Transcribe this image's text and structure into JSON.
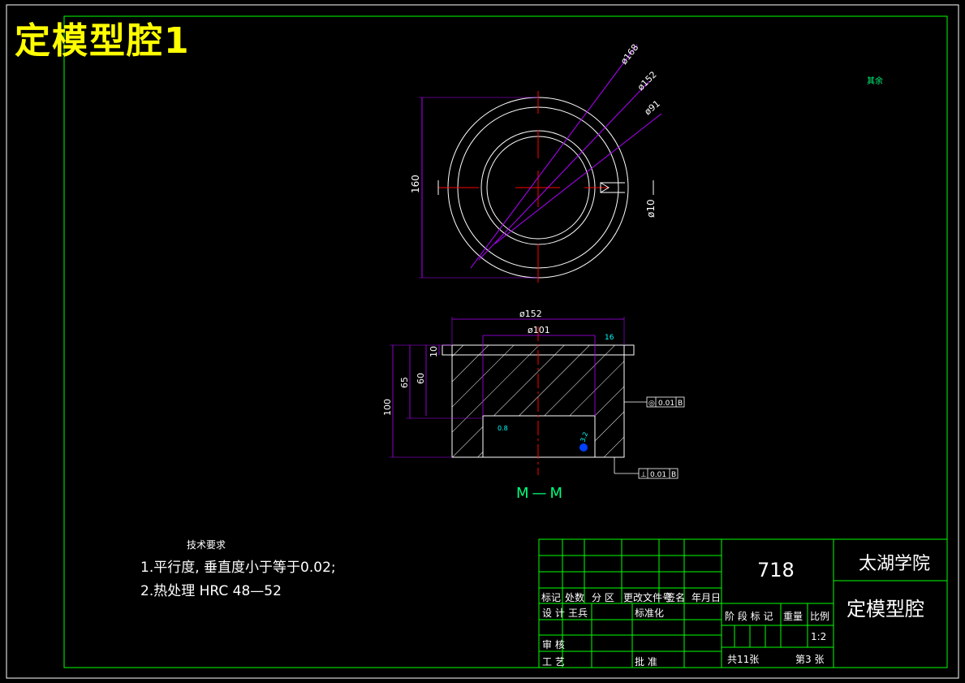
{
  "header": {
    "title": "定模型腔1"
  },
  "top_view": {
    "dims": {
      "d168": "ø168",
      "d152": "ø152",
      "d91": "ø91",
      "h160": "160",
      "d10": "ø10",
      "roughness_rest": "其余"
    }
  },
  "section_view": {
    "dims": {
      "d152": "ø152",
      "d101": "ø101",
      "h10": "10",
      "h60": "60",
      "h65": "65",
      "h100": "100",
      "rough16": "16",
      "rough08": "0.8",
      "rough32": "3.2"
    },
    "gdt": [
      {
        "symbol": "◎",
        "value": "0.01",
        "datum": "B"
      },
      {
        "symbol": "⊥",
        "value": "0.01",
        "datum": "B"
      }
    ],
    "label": "M—M"
  },
  "tech_requirements": {
    "title": "技术要求",
    "lines": [
      "1.平行度, 垂直度小于等于0.02;",
      "2.热处理  HRC  48—52"
    ]
  },
  "title_block": {
    "part_no": "718",
    "school": "太湖学院",
    "part_name": "定模型腔",
    "row_labels": {
      "mark": "标记",
      "count": "处数",
      "zone": "分 区",
      "change_doc": "更改文件号",
      "sign": "签名",
      "date": "年月日",
      "design": "设 计",
      "designer": "王兵",
      "standard": "标准化",
      "review": "审 核",
      "process": "工 艺",
      "approve": "批 准"
    },
    "stage_mark": "阶 段 标 记",
    "weight": "重量",
    "scale_label": "比例",
    "scale": "1:2",
    "total_sheets": "共11张",
    "sheet_no": "第3 张"
  }
}
